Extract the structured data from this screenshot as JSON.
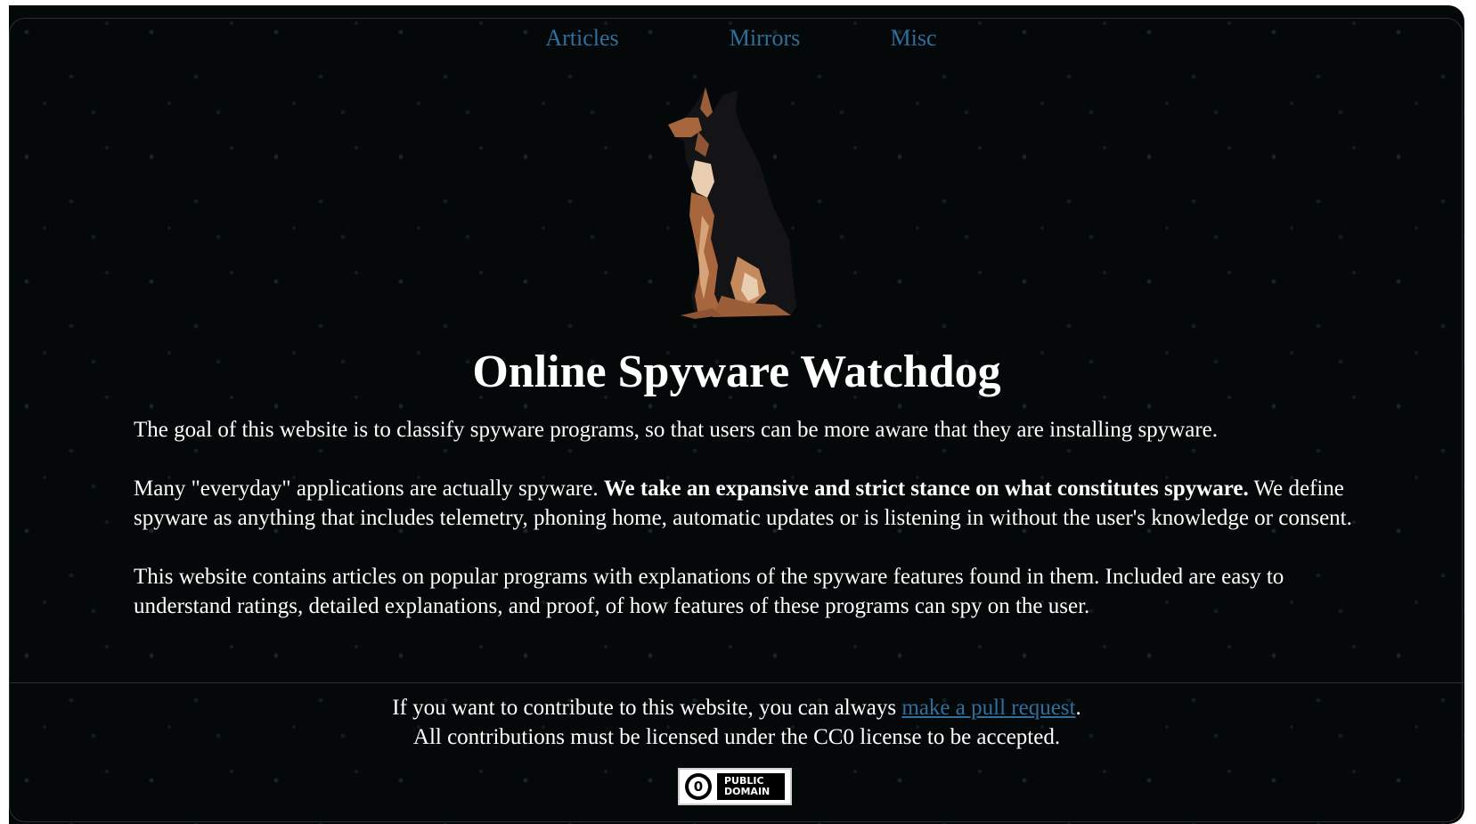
{
  "nav": {
    "items": [
      {
        "label": "Articles"
      },
      {
        "label": "Mirrors"
      },
      {
        "label": "Misc"
      }
    ]
  },
  "logo": {
    "icon": "watchdog-dog-logo"
  },
  "title": "Online Spyware Watchdog",
  "intro": {
    "p1": "The goal of this website is to classify spyware programs, so that users can be more aware that they are installing spyware.",
    "p2_start": "Many \"everyday\" applications are actually spyware. ",
    "p2_bold": "We take an expansive and strict stance on what constitutes spyware.",
    "p2_end": " We define spyware as anything that includes telemetry, phoning home, automatic updates or is listening in without the user's knowledge or consent.",
    "p3": "This website contains articles on popular programs with explanations of the spyware features found in them. Included are easy to understand ratings, detailed explanations, and proof, of how features of these programs can spy on the user."
  },
  "footer": {
    "line1_start": "If you want to contribute to this website, you can always ",
    "line1_link": "make a pull request",
    "line1_end": ".",
    "line2": "All contributions must be licensed under the CC0 license to be accepted."
  },
  "badge": {
    "symbol": "0",
    "line1": "PUBLIC",
    "line2": "DOMAIN",
    "icon": "public-domain-badge"
  },
  "colors": {
    "background": "#050808",
    "link": "#2e6f9e",
    "text": "#ffffff"
  }
}
